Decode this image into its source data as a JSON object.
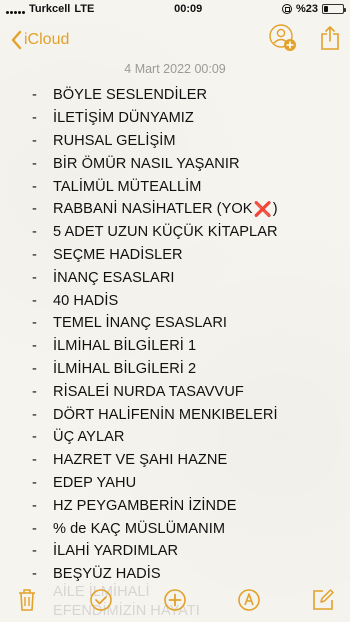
{
  "status_bar": {
    "carrier": "Turkcell",
    "network": "LTE",
    "time": "00:09",
    "battery_percent": "%23",
    "battery_level": 0.23
  },
  "nav": {
    "back_label": "iCloud",
    "back_icon": "chevron-left-icon",
    "accent_color": "#e2a12a",
    "add_person_icon": "add-person-icon",
    "share_icon": "share-icon"
  },
  "note": {
    "date": "4 Mart 2022 00:09",
    "dash": "-",
    "items": [
      {
        "text": "BÖYLE SESLENDİLER"
      },
      {
        "text": "İLETİŞİM DÜNYAMIZ"
      },
      {
        "text": "RUHSAL GELİŞİM"
      },
      {
        "text": "BİR ÖMÜR NASIL YAŞANIR"
      },
      {
        "text": "TALİMÜL MÜTEALLİM"
      },
      {
        "text": "RABBANİ NASİHATLER (YOK",
        "mark": "❌",
        "after": ")"
      },
      {
        "text": "5 ADET UZUN KÜÇÜK KİTAPLAR"
      },
      {
        "text": "SEÇME HADİSLER"
      },
      {
        "text": "İNANÇ ESASLARI"
      },
      {
        "text": "40 HADİS"
      },
      {
        "text": "TEMEL İNANÇ ESASLARI"
      },
      {
        "text": "İLMİHAL BİLGİLERİ 1"
      },
      {
        "text": "İLMİHAL BİLGİLERİ 2"
      },
      {
        "text": "RİSALEİ NURDA TASAVVUF"
      },
      {
        "text": "DÖRT HALİFENİN MENKIBELERİ"
      },
      {
        "text": "ÜÇ AYLAR"
      },
      {
        "text": "HAZRET VE ŞAHI HAZNE"
      },
      {
        "text": "EDEP YAHU"
      },
      {
        "text": "HZ PEYGAMBERİN İZİNDE"
      },
      {
        "text": "% de KAÇ MÜSLÜMANIM"
      },
      {
        "text": "İLAHİ YARDIMLAR"
      },
      {
        "text": "BEŞYÜZ HADİS"
      }
    ],
    "faded_lines": [
      "AİLE İLMİHALİ",
      "EFENDİMİZİN HAYATI"
    ]
  },
  "toolbar": {
    "icons": [
      "trash-icon",
      "checklist-icon",
      "add-icon",
      "markup-icon",
      "compose-icon"
    ]
  }
}
